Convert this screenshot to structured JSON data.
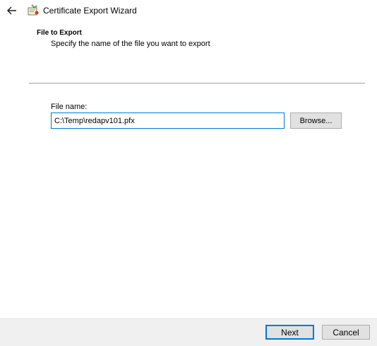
{
  "window": {
    "title": "Certificate Export Wizard",
    "back_icon": "arrow-left-icon",
    "app_icon": "certificate-wizard-icon"
  },
  "header": {
    "title": "File to Export",
    "subtitle": "Specify the name of the file you want to export"
  },
  "form": {
    "file_name_label": "File name:",
    "file_name_value": "C:\\Temp\\redapv101.pfx",
    "browse_label": "Browse..."
  },
  "footer": {
    "next_label": "Next",
    "cancel_label": "Cancel"
  },
  "colors": {
    "accent": "#0078d7",
    "button_face": "#e1e1e1",
    "footer_bg": "#f0f0f0"
  }
}
